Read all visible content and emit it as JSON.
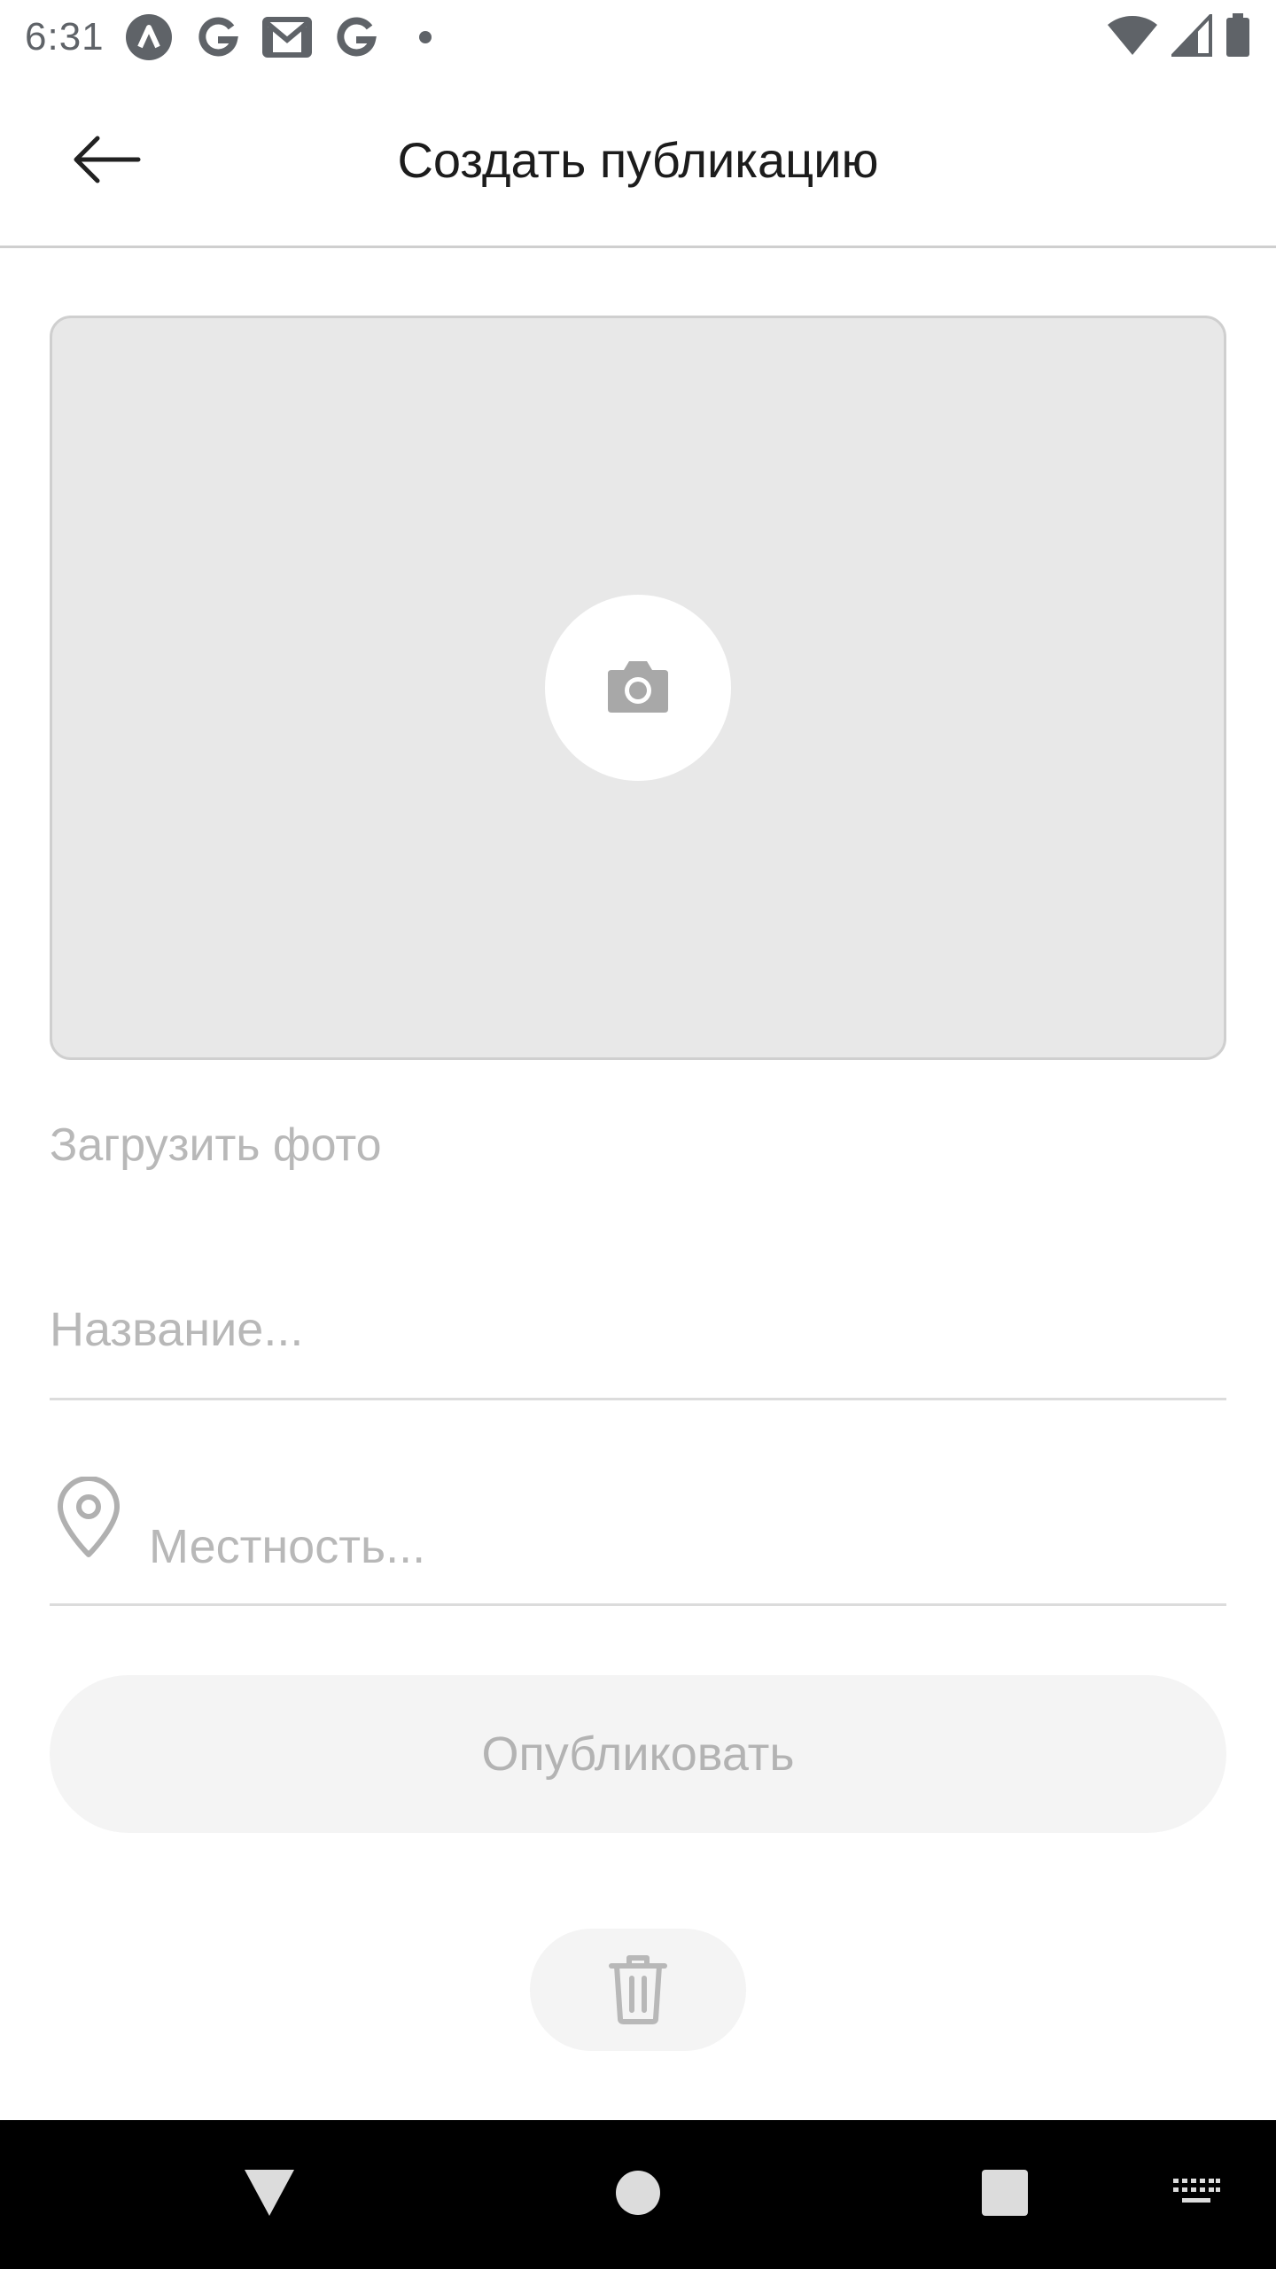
{
  "status_bar": {
    "time": "6:31",
    "notification_icons": [
      "app-a-icon",
      "google-icon",
      "gmail-icon",
      "google-icon",
      "dot-icon"
    ],
    "system_icons": [
      "wifi-icon",
      "signal-icon",
      "battery-icon"
    ]
  },
  "app_bar": {
    "back_icon": "arrow-back-icon",
    "title": "Создать публикацию"
  },
  "photo": {
    "icon": "camera-icon",
    "upload_label": "Загрузить фото"
  },
  "form": {
    "title_placeholder": "Название...",
    "title_value": "",
    "location_icon": "location-pin-icon",
    "location_placeholder": "Местность...",
    "location_value": ""
  },
  "actions": {
    "publish_label": "Опубликовать",
    "delete_icon": "trash-icon"
  },
  "nav_bar": {
    "icons": [
      "back-triangle-icon",
      "home-circle-icon",
      "recents-square-icon",
      "keyboard-icon"
    ]
  },
  "colors": {
    "placeholder": "#b8b8b8",
    "photo_bg": "#e8e8e8",
    "button_bg": "#f4f4f4",
    "nav_bg": "#000000"
  }
}
